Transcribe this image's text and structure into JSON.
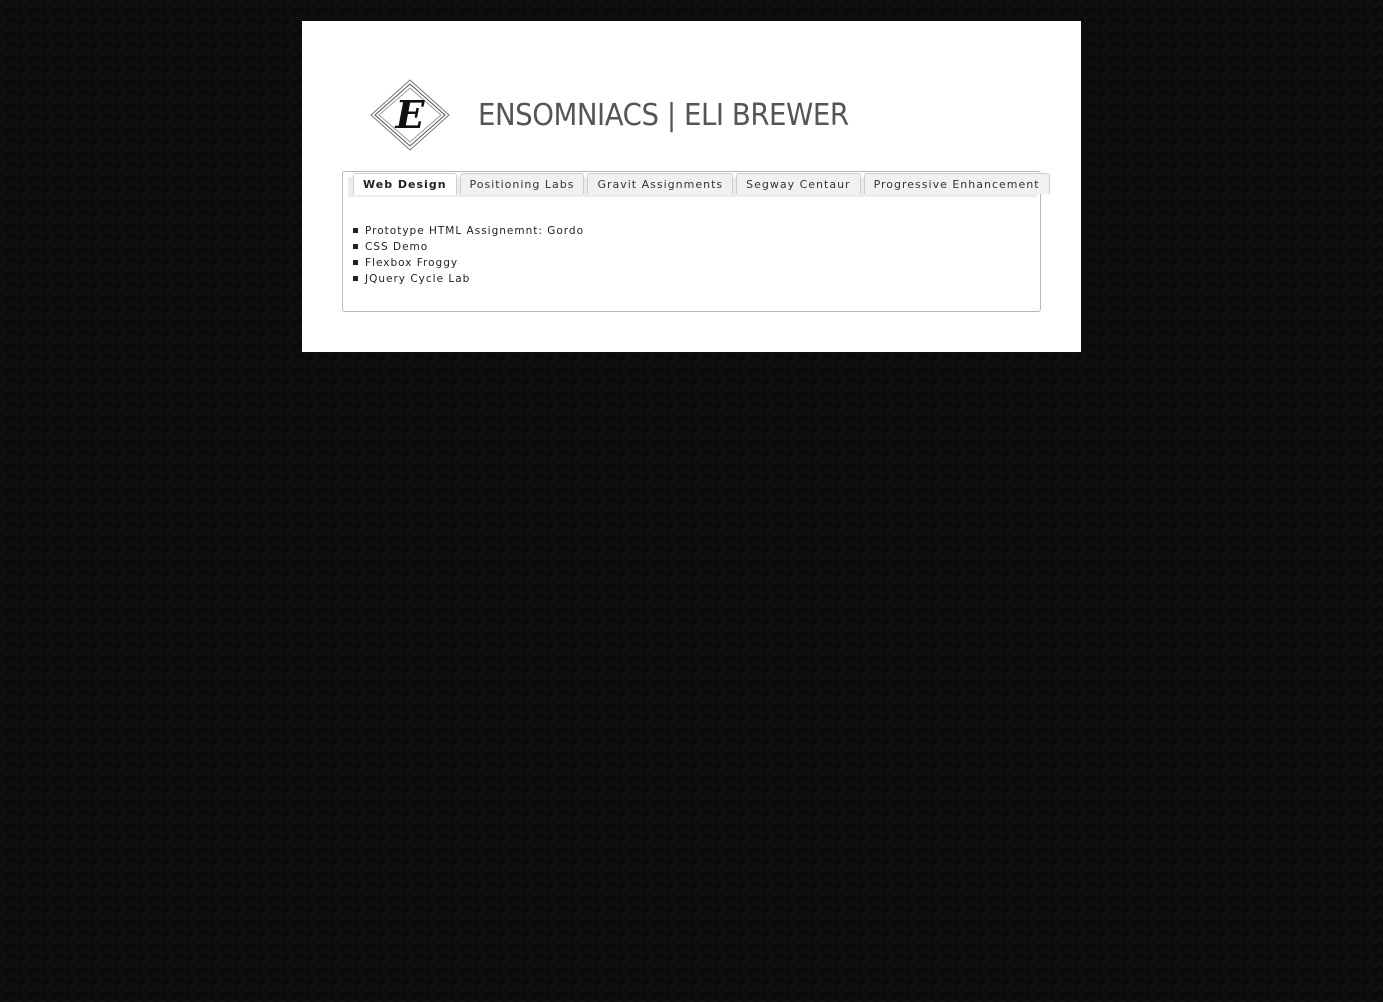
{
  "header": {
    "title": "ENSOMNIACS | ELI BREWER",
    "logo_letter": "E",
    "logo_icon": "diamond-e-monogram-icon"
  },
  "tabs": [
    {
      "label": "Web Design",
      "active": true
    },
    {
      "label": "Positioning Labs",
      "active": false
    },
    {
      "label": "Gravit Assignments",
      "active": false
    },
    {
      "label": "Segway Centaur",
      "active": false
    },
    {
      "label": "Progressive Enhancement",
      "active": false
    }
  ],
  "links": [
    {
      "label": "Prototype HTML Assignemnt: Gordo"
    },
    {
      "label": "CSS Demo"
    },
    {
      "label": "Flexbox Froggy"
    },
    {
      "label": "JQuery Cycle Lab"
    }
  ]
}
